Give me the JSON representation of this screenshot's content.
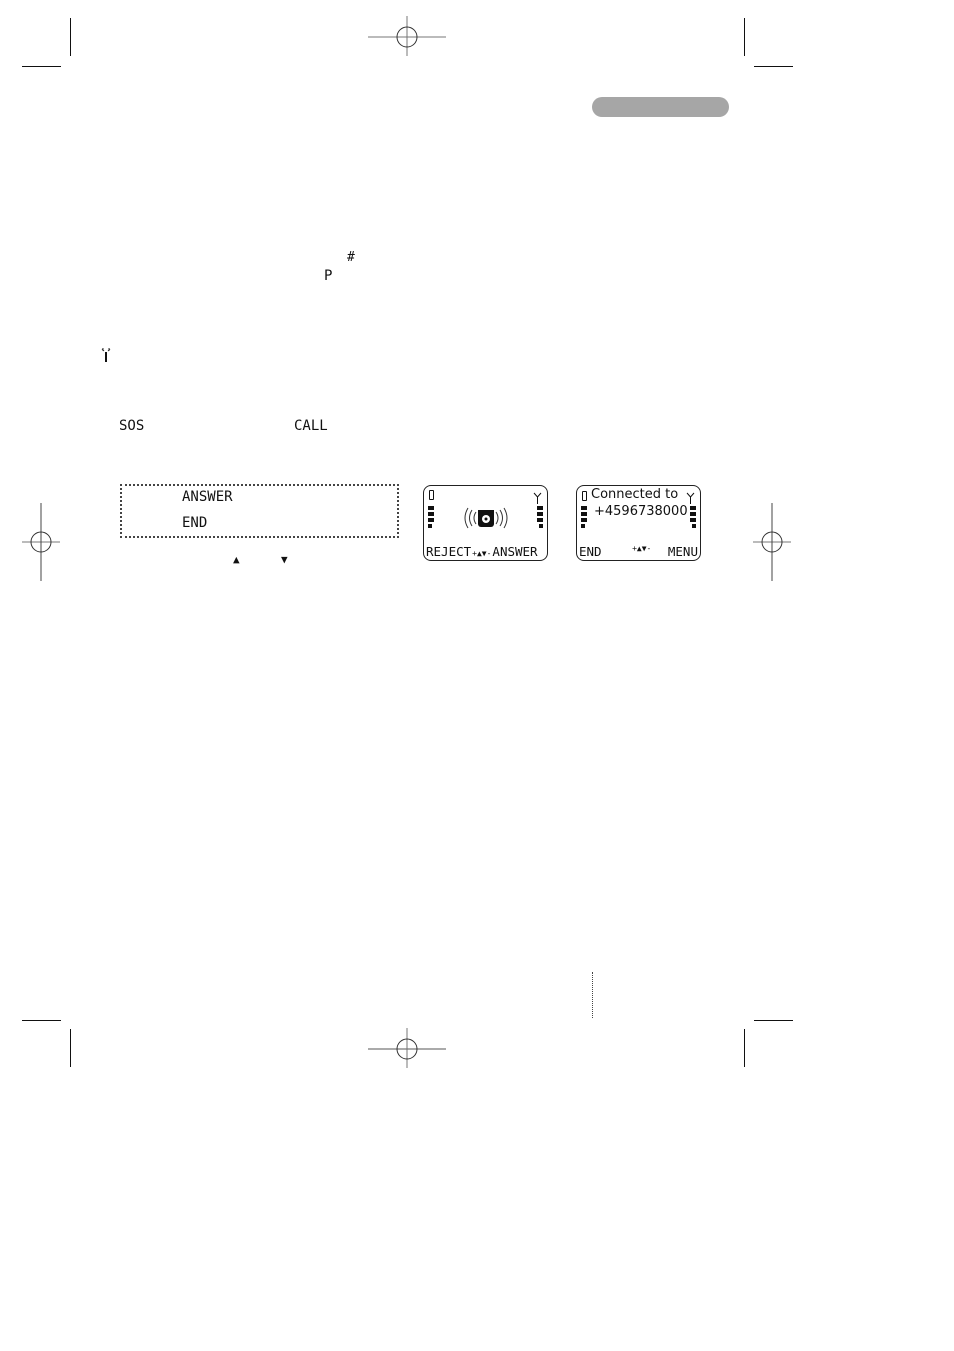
{
  "page": {
    "header_tab": {
      "color": "#a6a6a6"
    },
    "symbols": {
      "hash_key": "#",
      "pause_key": "P",
      "antenna_icon": "antenna-icon"
    },
    "keys": {
      "sos": "SOS",
      "call": "CALL"
    },
    "menu": {
      "items": [
        {
          "label": "ANSWER"
        },
        {
          "label": "END"
        }
      ],
      "nav_up": "▲",
      "nav_down": "▼"
    },
    "screen_incoming": {
      "softkey_left": "REJECT",
      "softkey_right": "ANSWER",
      "center_icon": "ringing-phone-icon"
    },
    "screen_connected": {
      "line1": "Connected to",
      "line2": "+4596738000",
      "softkey_left": "END",
      "softkey_right": "MENU"
    }
  }
}
